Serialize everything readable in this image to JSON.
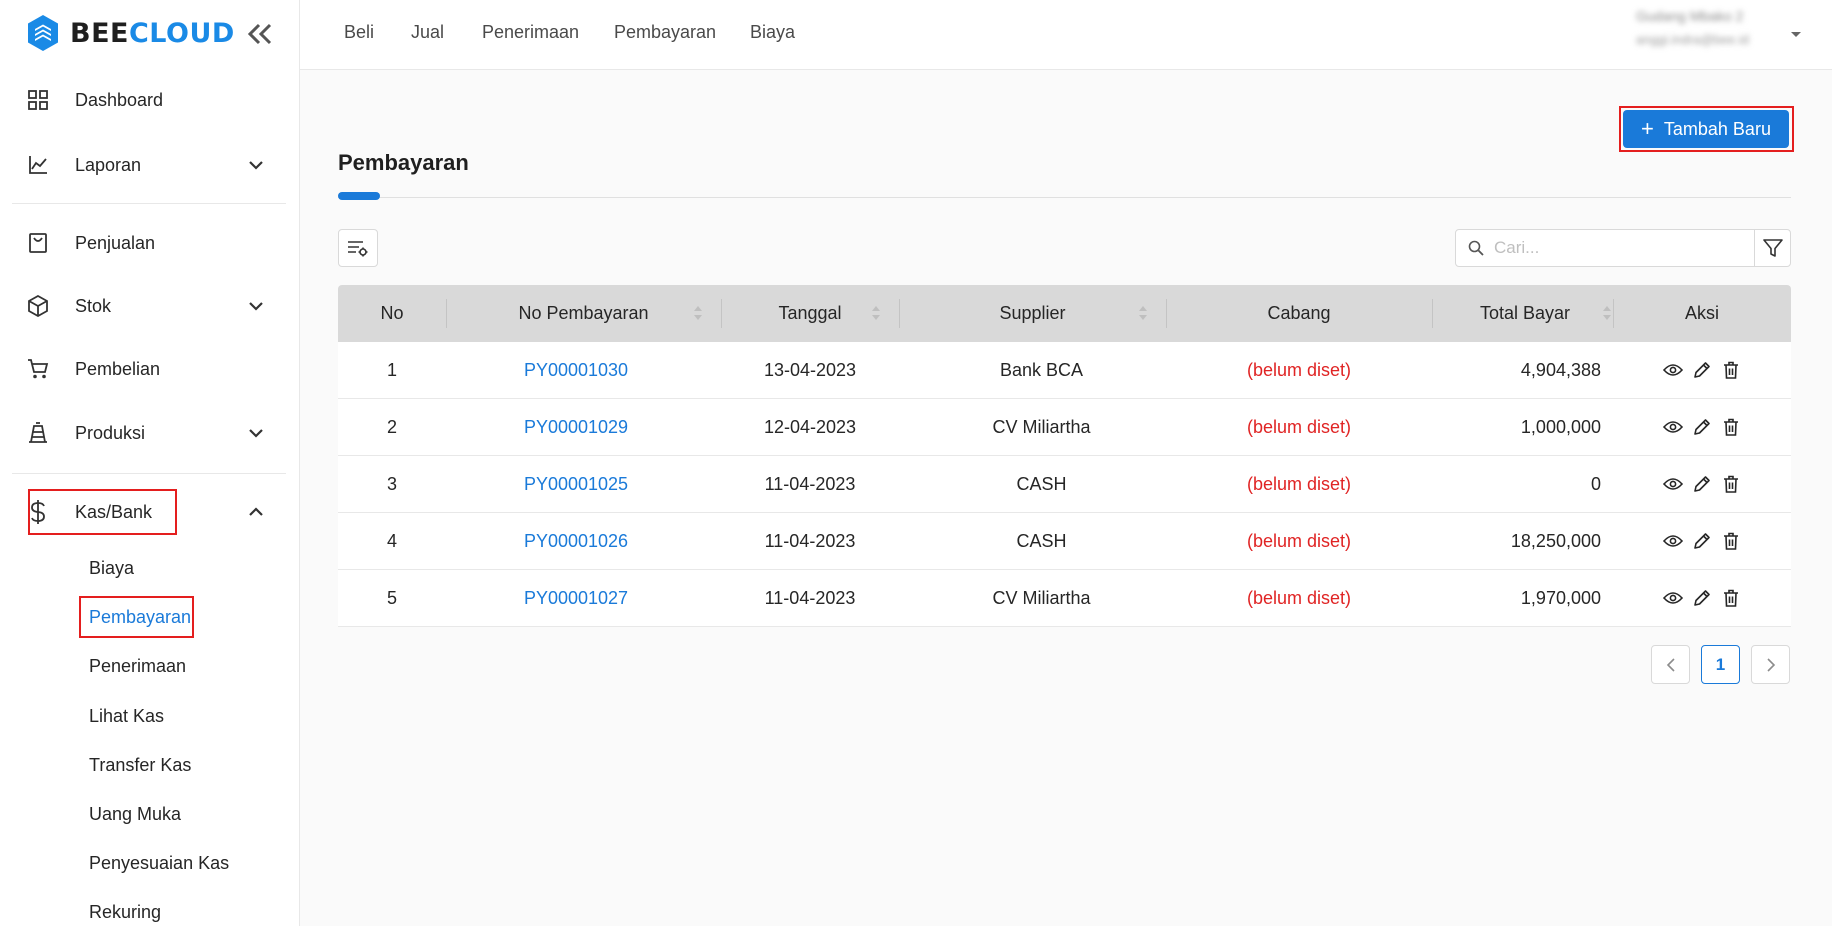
{
  "brand": {
    "part1": "BEE",
    "part2": "CLOUD"
  },
  "sidebar": {
    "items": [
      {
        "label": "Dashboard"
      },
      {
        "label": "Laporan"
      },
      {
        "label": "Penjualan"
      },
      {
        "label": "Stok"
      },
      {
        "label": "Pembelian"
      },
      {
        "label": "Produksi"
      },
      {
        "label": "Kas/Bank"
      }
    ],
    "submenu": [
      {
        "label": "Biaya"
      },
      {
        "label": "Pembayaran"
      },
      {
        "label": "Penerimaan"
      },
      {
        "label": "Lihat Kas"
      },
      {
        "label": "Transfer Kas"
      },
      {
        "label": "Uang Muka"
      },
      {
        "label": "Penyesuaian Kas"
      },
      {
        "label": "Rekuring"
      }
    ]
  },
  "topnav": {
    "links": [
      {
        "label": "Beli"
      },
      {
        "label": "Jual"
      },
      {
        "label": "Penerimaan"
      },
      {
        "label": "Pembayaran"
      },
      {
        "label": "Biaya"
      }
    ],
    "user": {
      "name": "Gudang Mbako 2",
      "email": "anggi.indra@bee.id"
    }
  },
  "main": {
    "add_button": "Tambah Baru",
    "title": "Pembayaran",
    "search_placeholder": "Cari..."
  },
  "table": {
    "headers": {
      "no": "No",
      "no_pembayaran": "No Pembayaran",
      "tanggal": "Tanggal",
      "supplier": "Supplier",
      "cabang": "Cabang",
      "total_bayar": "Total Bayar",
      "aksi": "Aksi"
    },
    "rows": [
      {
        "no": "1",
        "no_pembayaran": "PY00001030",
        "tanggal": "13-04-2023",
        "supplier": "Bank BCA",
        "cabang": "(belum diset)",
        "total_bayar": "4,904,388"
      },
      {
        "no": "2",
        "no_pembayaran": "PY00001029",
        "tanggal": "12-04-2023",
        "supplier": "CV Miliartha",
        "cabang": "(belum diset)",
        "total_bayar": "1,000,000"
      },
      {
        "no": "3",
        "no_pembayaran": "PY00001025",
        "tanggal": "11-04-2023",
        "supplier": "CASH",
        "cabang": "(belum diset)",
        "total_bayar": "0"
      },
      {
        "no": "4",
        "no_pembayaran": "PY00001026",
        "tanggal": "11-04-2023",
        "supplier": "CASH",
        "cabang": "(belum diset)",
        "total_bayar": "18,250,000"
      },
      {
        "no": "5",
        "no_pembayaran": "PY00001027",
        "tanggal": "11-04-2023",
        "supplier": "CV Miliartha",
        "cabang": "(belum diset)",
        "total_bayar": "1,970,000"
      }
    ]
  },
  "pagination": {
    "current": "1"
  },
  "colors": {
    "accent": "#1a7ad9",
    "danger": "#e02424",
    "highlight": "#e41e1e"
  }
}
